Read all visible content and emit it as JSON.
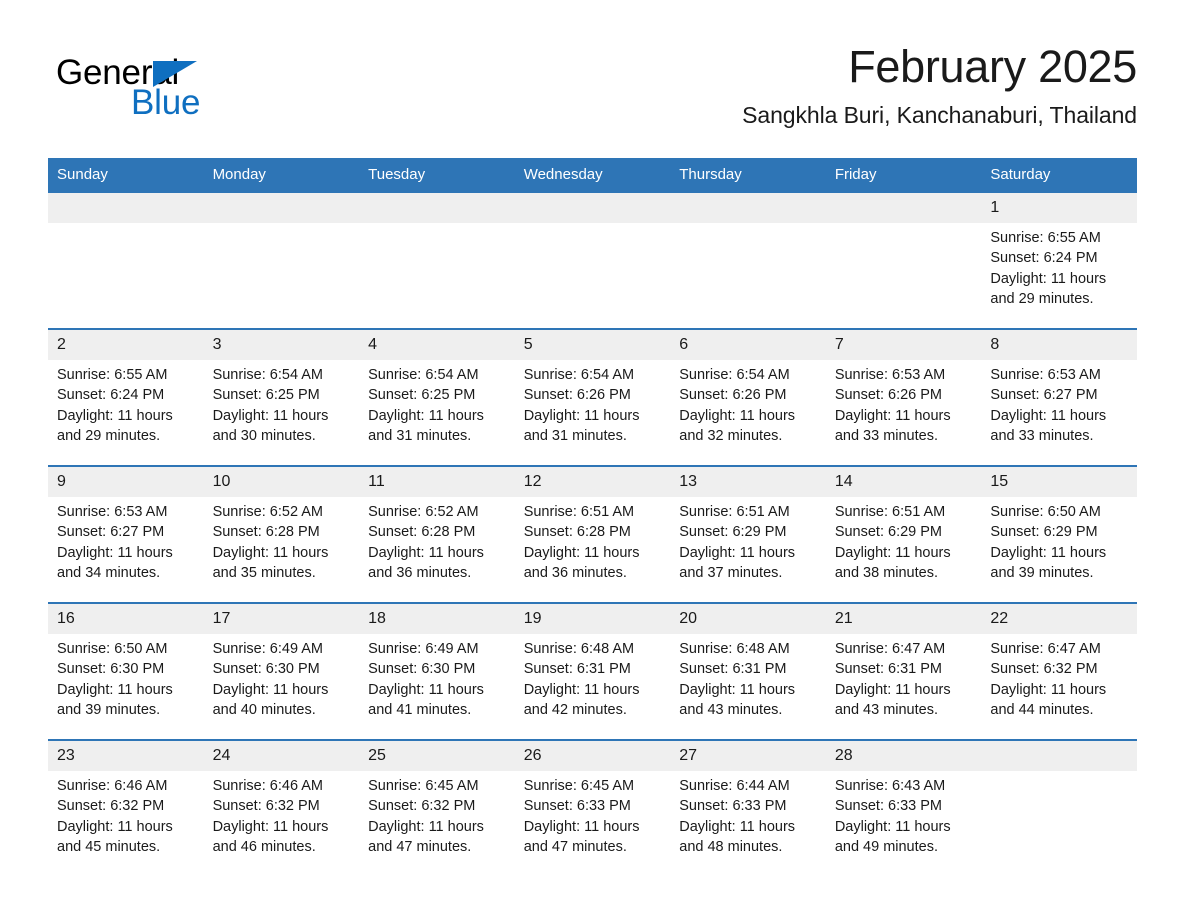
{
  "logo": {
    "part1": "General",
    "part2": "Blue",
    "triangle_color": "#0F6FC0"
  },
  "header": {
    "title": "February 2025",
    "subtitle": "Sangkhla Buri, Kanchanaburi, Thailand",
    "accent_color": "#2E75B6"
  },
  "weekday_headers": [
    "Sunday",
    "Monday",
    "Tuesday",
    "Wednesday",
    "Thursday",
    "Friday",
    "Saturday"
  ],
  "weeks": [
    [
      {
        "day": "",
        "empty": true
      },
      {
        "day": "",
        "empty": true
      },
      {
        "day": "",
        "empty": true
      },
      {
        "day": "",
        "empty": true
      },
      {
        "day": "",
        "empty": true
      },
      {
        "day": "",
        "empty": true
      },
      {
        "day": "1",
        "sunrise": "Sunrise: 6:55 AM",
        "sunset": "Sunset: 6:24 PM",
        "daylight": "Daylight: 11 hours and 29 minutes."
      }
    ],
    [
      {
        "day": "2",
        "sunrise": "Sunrise: 6:55 AM",
        "sunset": "Sunset: 6:24 PM",
        "daylight": "Daylight: 11 hours and 29 minutes."
      },
      {
        "day": "3",
        "sunrise": "Sunrise: 6:54 AM",
        "sunset": "Sunset: 6:25 PM",
        "daylight": "Daylight: 11 hours and 30 minutes."
      },
      {
        "day": "4",
        "sunrise": "Sunrise: 6:54 AM",
        "sunset": "Sunset: 6:25 PM",
        "daylight": "Daylight: 11 hours and 31 minutes."
      },
      {
        "day": "5",
        "sunrise": "Sunrise: 6:54 AM",
        "sunset": "Sunset: 6:26 PM",
        "daylight": "Daylight: 11 hours and 31 minutes."
      },
      {
        "day": "6",
        "sunrise": "Sunrise: 6:54 AM",
        "sunset": "Sunset: 6:26 PM",
        "daylight": "Daylight: 11 hours and 32 minutes."
      },
      {
        "day": "7",
        "sunrise": "Sunrise: 6:53 AM",
        "sunset": "Sunset: 6:26 PM",
        "daylight": "Daylight: 11 hours and 33 minutes."
      },
      {
        "day": "8",
        "sunrise": "Sunrise: 6:53 AM",
        "sunset": "Sunset: 6:27 PM",
        "daylight": "Daylight: 11 hours and 33 minutes."
      }
    ],
    [
      {
        "day": "9",
        "sunrise": "Sunrise: 6:53 AM",
        "sunset": "Sunset: 6:27 PM",
        "daylight": "Daylight: 11 hours and 34 minutes."
      },
      {
        "day": "10",
        "sunrise": "Sunrise: 6:52 AM",
        "sunset": "Sunset: 6:28 PM",
        "daylight": "Daylight: 11 hours and 35 minutes."
      },
      {
        "day": "11",
        "sunrise": "Sunrise: 6:52 AM",
        "sunset": "Sunset: 6:28 PM",
        "daylight": "Daylight: 11 hours and 36 minutes."
      },
      {
        "day": "12",
        "sunrise": "Sunrise: 6:51 AM",
        "sunset": "Sunset: 6:28 PM",
        "daylight": "Daylight: 11 hours and 36 minutes."
      },
      {
        "day": "13",
        "sunrise": "Sunrise: 6:51 AM",
        "sunset": "Sunset: 6:29 PM",
        "daylight": "Daylight: 11 hours and 37 minutes."
      },
      {
        "day": "14",
        "sunrise": "Sunrise: 6:51 AM",
        "sunset": "Sunset: 6:29 PM",
        "daylight": "Daylight: 11 hours and 38 minutes."
      },
      {
        "day": "15",
        "sunrise": "Sunrise: 6:50 AM",
        "sunset": "Sunset: 6:29 PM",
        "daylight": "Daylight: 11 hours and 39 minutes."
      }
    ],
    [
      {
        "day": "16",
        "sunrise": "Sunrise: 6:50 AM",
        "sunset": "Sunset: 6:30 PM",
        "daylight": "Daylight: 11 hours and 39 minutes."
      },
      {
        "day": "17",
        "sunrise": "Sunrise: 6:49 AM",
        "sunset": "Sunset: 6:30 PM",
        "daylight": "Daylight: 11 hours and 40 minutes."
      },
      {
        "day": "18",
        "sunrise": "Sunrise: 6:49 AM",
        "sunset": "Sunset: 6:30 PM",
        "daylight": "Daylight: 11 hours and 41 minutes."
      },
      {
        "day": "19",
        "sunrise": "Sunrise: 6:48 AM",
        "sunset": "Sunset: 6:31 PM",
        "daylight": "Daylight: 11 hours and 42 minutes."
      },
      {
        "day": "20",
        "sunrise": "Sunrise: 6:48 AM",
        "sunset": "Sunset: 6:31 PM",
        "daylight": "Daylight: 11 hours and 43 minutes."
      },
      {
        "day": "21",
        "sunrise": "Sunrise: 6:47 AM",
        "sunset": "Sunset: 6:31 PM",
        "daylight": "Daylight: 11 hours and 43 minutes."
      },
      {
        "day": "22",
        "sunrise": "Sunrise: 6:47 AM",
        "sunset": "Sunset: 6:32 PM",
        "daylight": "Daylight: 11 hours and 44 minutes."
      }
    ],
    [
      {
        "day": "23",
        "sunrise": "Sunrise: 6:46 AM",
        "sunset": "Sunset: 6:32 PM",
        "daylight": "Daylight: 11 hours and 45 minutes."
      },
      {
        "day": "24",
        "sunrise": "Sunrise: 6:46 AM",
        "sunset": "Sunset: 6:32 PM",
        "daylight": "Daylight: 11 hours and 46 minutes."
      },
      {
        "day": "25",
        "sunrise": "Sunrise: 6:45 AM",
        "sunset": "Sunset: 6:32 PM",
        "daylight": "Daylight: 11 hours and 47 minutes."
      },
      {
        "day": "26",
        "sunrise": "Sunrise: 6:45 AM",
        "sunset": "Sunset: 6:33 PM",
        "daylight": "Daylight: 11 hours and 47 minutes."
      },
      {
        "day": "27",
        "sunrise": "Sunrise: 6:44 AM",
        "sunset": "Sunset: 6:33 PM",
        "daylight": "Daylight: 11 hours and 48 minutes."
      },
      {
        "day": "28",
        "sunrise": "Sunrise: 6:43 AM",
        "sunset": "Sunset: 6:33 PM",
        "daylight": "Daylight: 11 hours and 49 minutes."
      },
      {
        "day": "",
        "empty": true
      }
    ]
  ]
}
